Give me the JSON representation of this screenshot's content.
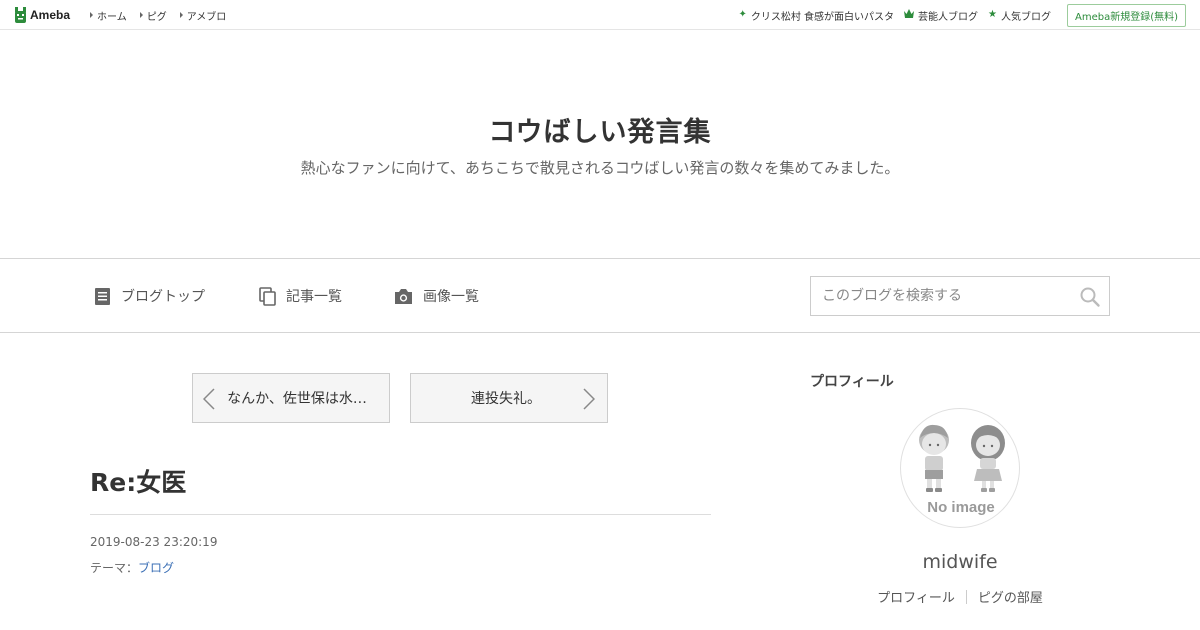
{
  "topbar": {
    "logo_text": "Ameba",
    "nav": [
      "ホーム",
      "ピグ",
      "アメブロ"
    ],
    "links": [
      {
        "icon": "sparkle-icon",
        "label": "クリス松村 食感が面白いパスタ"
      },
      {
        "icon": "crown-icon",
        "label": "芸能人ブログ"
      },
      {
        "icon": "star-icon",
        "label": "人気ブログ"
      }
    ],
    "register_label": "Ameba新規登録(無料)",
    "accent_color": "#2d8c3c"
  },
  "header": {
    "title": "コウばしい発言集",
    "description": "熱心なファンに向けて、あちこちで散見されるコウばしい発言の数々を集めてみました。"
  },
  "nav": {
    "items": [
      {
        "icon": "document-icon",
        "label": "ブログトップ"
      },
      {
        "icon": "copy-icon",
        "label": "記事一覧"
      },
      {
        "icon": "camera-icon",
        "label": "画像一覧"
      }
    ],
    "search_placeholder": "このブログを検索する"
  },
  "pager": {
    "prev_label": "なんか、佐世保は水…",
    "next_label": "連投失礼。"
  },
  "article": {
    "title": "Re:女医",
    "date": "2019-08-23 23:20:19",
    "theme_prefix": "テーマ：",
    "theme_link": "ブログ"
  },
  "sidebar": {
    "heading": "プロフィール",
    "avatar_text": "No image",
    "username": "midwife",
    "links": [
      "プロフィール",
      "ピグの部屋"
    ]
  }
}
